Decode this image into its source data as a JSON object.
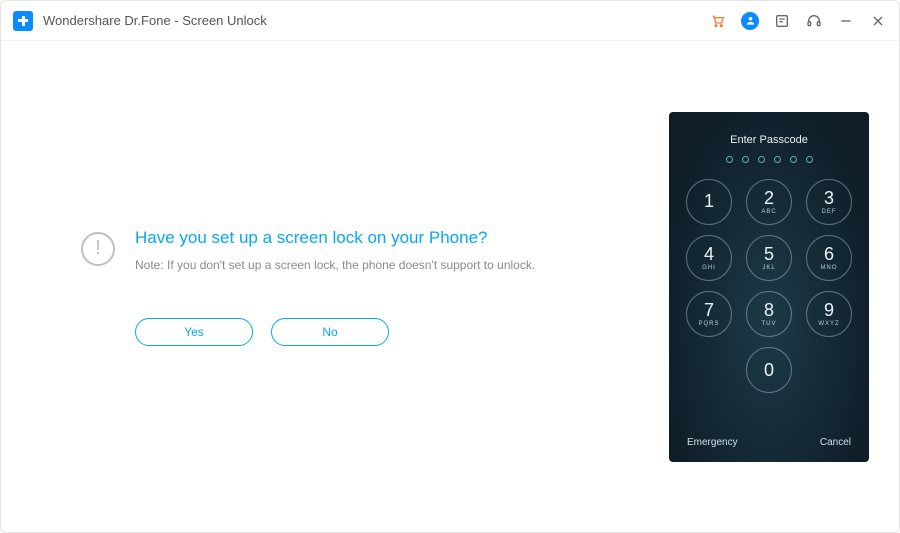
{
  "titlebar": {
    "app_title": "Wondershare Dr.Fone - Screen Unlock"
  },
  "main": {
    "heading": "Have you set up a screen lock on your Phone?",
    "note": "Note: If you don't set up a screen lock, the phone doesn't support to unlock.",
    "yes_label": "Yes",
    "no_label": "No"
  },
  "phone": {
    "title": "Enter Passcode",
    "emergency_label": "Emergency",
    "cancel_label": "Cancel",
    "keys": [
      {
        "num": "1",
        "let": ""
      },
      {
        "num": "2",
        "let": "ABC"
      },
      {
        "num": "3",
        "let": "DEF"
      },
      {
        "num": "4",
        "let": "GHI"
      },
      {
        "num": "5",
        "let": "JKL"
      },
      {
        "num": "6",
        "let": "MNO"
      },
      {
        "num": "7",
        "let": "PQRS"
      },
      {
        "num": "8",
        "let": "TUV"
      },
      {
        "num": "9",
        "let": "WXYZ"
      },
      {
        "num": "0",
        "let": ""
      }
    ]
  }
}
